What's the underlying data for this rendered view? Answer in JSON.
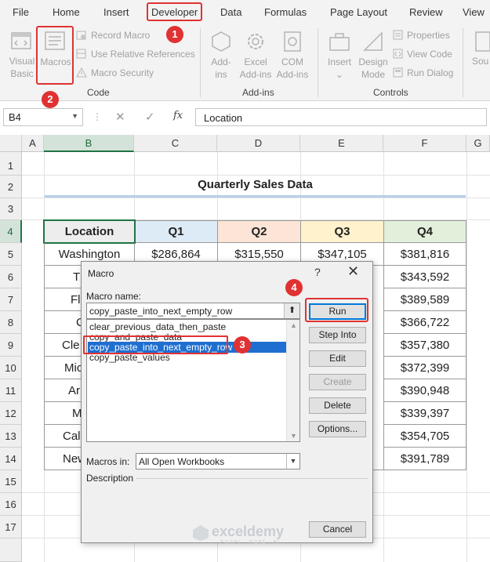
{
  "ribbon_tabs": [
    "File",
    "Home",
    "Insert",
    "Developer",
    "Data",
    "Formulas",
    "Page Layout",
    "Review",
    "View"
  ],
  "code_group": {
    "visual_basic": "Visual Basic",
    "macros": "Macros",
    "record_macro": "Record Macro",
    "relative_refs": "Use Relative References",
    "macro_security": "Macro Security",
    "title": "Code"
  },
  "addins_group": {
    "addins": "Add-ins",
    "excel_addins": "Excel Add-ins",
    "com_addins": "COM Add-ins",
    "title": "Add-ins"
  },
  "controls_group": {
    "insert": "Insert",
    "design_mode": "Design Mode",
    "properties": "Properties",
    "view_code": "View Code",
    "run_dialog": "Run Dialog",
    "title": "Controls"
  },
  "source_partial": "Sou",
  "callouts": [
    "1",
    "2",
    "3",
    "4"
  ],
  "formula_bar": {
    "name_box": "B4",
    "fx": "fx",
    "cancel": "✕",
    "enter": "✓",
    "content": "Location"
  },
  "columns": [
    "A",
    "B",
    "C",
    "D",
    "E",
    "F",
    "G"
  ],
  "rows": [
    "1",
    "2",
    "3",
    "4",
    "5",
    "6",
    "7",
    "8",
    "9",
    "10",
    "11",
    "12",
    "13",
    "14",
    "15",
    "16",
    "17"
  ],
  "sheet": {
    "title": "Quarterly Sales Data",
    "headers": [
      "Location",
      "Q1",
      "Q2",
      "Q3",
      "Q4"
    ],
    "locations_visible": [
      "Washington",
      "T",
      "Fl",
      "C",
      "Cle",
      "Mic",
      "Ar",
      "M",
      "Cali",
      "New"
    ],
    "q1_first": "$286,864",
    "q2_first": "$315,550",
    "q3_first": "$347,105",
    "q4": [
      "$381,816",
      "$343,592",
      "$389,589",
      "$366,722",
      "$357,380",
      "$372,399",
      "$390,948",
      "$339,397",
      "$354,705",
      "$391,789"
    ]
  },
  "dialog": {
    "title": "Macro",
    "help": "?",
    "close": "✕",
    "macro_name_label": "Macro name:",
    "macro_name_value": "copy_paste_into_next_empty_row",
    "macros": [
      "clear_previous_data_then_paste",
      "copy_and_paste_data",
      "copy_paste_into_next_empty_row",
      "copy_paste_values"
    ],
    "selected_index": 2,
    "buttons": [
      "Run",
      "Step Into",
      "Edit",
      "Create",
      "Delete",
      "Options...",
      "Cancel"
    ],
    "macros_in_label": "Macros in:",
    "macros_in_value": "All Open Workbooks",
    "description_label": "Description"
  },
  "watermark": {
    "name": "exceldemy",
    "tagline": "EXCEL · DATA · BI"
  },
  "colors": {
    "accent_red": "#e03232",
    "excel_green": "#217346",
    "q1_header": "#ddebf7",
    "q2_header": "#fce4d6",
    "q3_header": "#fff2cc",
    "q4_header": "#e2efda",
    "location_header": "#ededed",
    "selection_blue": "#1f6fd0"
  }
}
